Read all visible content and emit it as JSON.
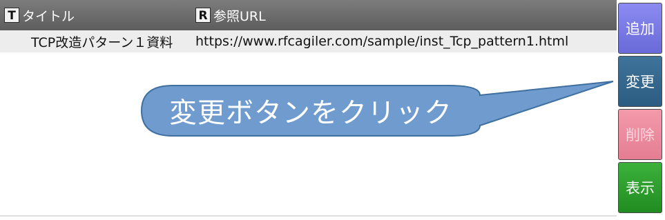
{
  "grid": {
    "columns": [
      {
        "icon": "T",
        "label": "タイトル"
      },
      {
        "icon": "R",
        "label": "参照URL"
      }
    ],
    "rows": [
      {
        "title": "TCP改造パターン１資料",
        "url": "https://www.rfcagiler.com/sample/inst_Tcp_pattern1.html"
      }
    ]
  },
  "buttons": {
    "add": "追加",
    "change": "変更",
    "delete": "削除",
    "show": "表示"
  },
  "callout": {
    "text": "変更ボタンをクリック"
  },
  "colors": {
    "header": "#6b6b6b",
    "add_button": "#7a7ae6",
    "change_button": "#35688e",
    "delete_button": "#ec8ca0",
    "show_button": "#2a9e2a",
    "callout_fill": "#6f9bcf",
    "callout_stroke": "#3f6f9f"
  }
}
